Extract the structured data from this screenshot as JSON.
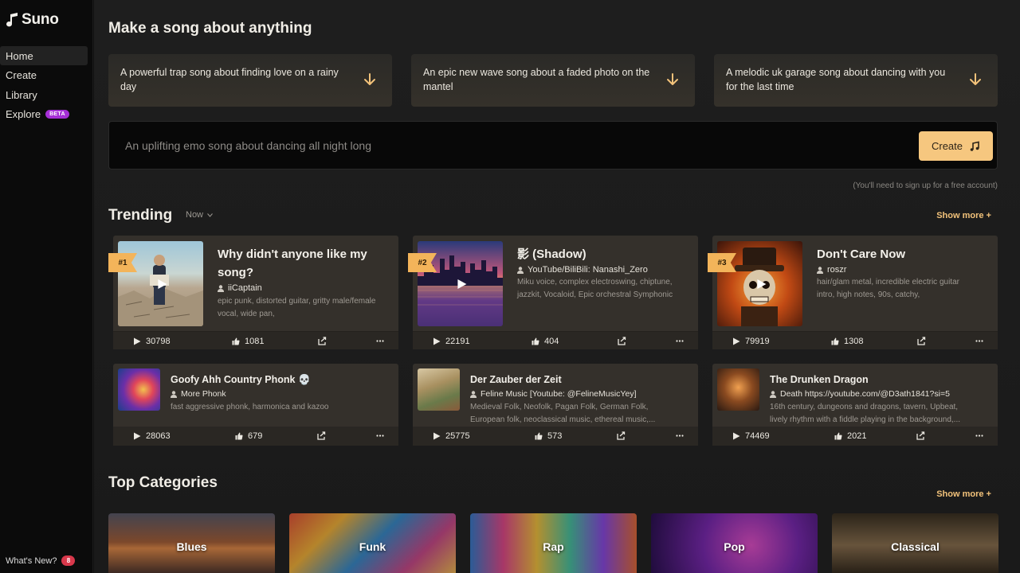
{
  "app": {
    "name": "Suno"
  },
  "sidebar": {
    "items": [
      {
        "label": "Home",
        "active": true
      },
      {
        "label": "Create"
      },
      {
        "label": "Library"
      },
      {
        "label": "Explore",
        "badge": "BETA"
      }
    ],
    "whats_new": {
      "label": "What's New?",
      "count": "8"
    }
  },
  "header": {
    "title": "Make a song about anything"
  },
  "prompts": [
    {
      "text": "A powerful trap song about finding love on a rainy day"
    },
    {
      "text": "An epic new wave song about a faded photo on the mantel"
    },
    {
      "text": "A melodic uk garage song about dancing with you for the last time"
    }
  ],
  "create": {
    "placeholder": "An uplifting emo song about dancing all night long",
    "button_label": "Create",
    "note": "(You'll need to sign up for a free account)"
  },
  "trending": {
    "title": "Trending",
    "filter": "Now",
    "show_more": "Show more +",
    "top": [
      {
        "rank": "#1",
        "title": "Why didn't anyone like my song?",
        "author": "iiCaptain",
        "desc": "epic punk, distorted guitar, gritty male/female vocal, wide pan,",
        "plays": "30798",
        "likes": "1081"
      },
      {
        "rank": "#2",
        "title": "影 (Shadow)",
        "author": "YouTube/BiliBili: Nanashi_Zero",
        "desc": "Miku voice, complex electroswing, chiptune, jazzkit, Vocaloid, Epic orchestral Symphonic",
        "plays": "22191",
        "likes": "404"
      },
      {
        "rank": "#3",
        "title": "Don't Care Now",
        "author": "roszr",
        "desc": "hair/glam metal, incredible electric guitar intro, high notes, 90s, catchy,",
        "plays": "79919",
        "likes": "1308"
      }
    ],
    "more": [
      {
        "title": "Goofy Ahh Country Phonk 💀",
        "author": "More Phonk",
        "desc": "fast aggressive phonk, harmonica and kazoo",
        "plays": "28063",
        "likes": "679"
      },
      {
        "title": "Der Zauber der Zeit",
        "author": "Feline Music [Youtube: @FelineMusicYey]",
        "desc": "Medieval Folk, Neofolk, Pagan Folk, German Folk, European folk, neoclassical music, ethereal music,...",
        "plays": "25775",
        "likes": "573"
      },
      {
        "title": "The Drunken Dragon",
        "author": "Death https://youtube.com/@D3ath1841?si=5",
        "desc": "16th century, dungeons and dragons, tavern, Upbeat, lively rhythm with a fiddle playing in the background,...",
        "plays": "74469",
        "likes": "2021"
      }
    ]
  },
  "categories": {
    "title": "Top Categories",
    "show_more": "Show more +",
    "items": [
      {
        "label": "Blues"
      },
      {
        "label": "Funk"
      },
      {
        "label": "Rap"
      },
      {
        "label": "Pop"
      },
      {
        "label": "Classical"
      }
    ]
  },
  "colors": {
    "accent": "#f6c77f",
    "rank": "#f3b45a",
    "beta": "#a52fd6",
    "notification": "#d8384b"
  }
}
